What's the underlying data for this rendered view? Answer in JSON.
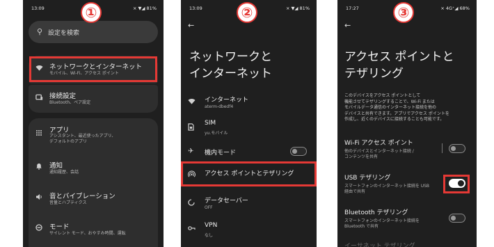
{
  "steps": [
    "①",
    "②",
    "③"
  ],
  "screen1": {
    "status": {
      "time": "13:09",
      "icons": "⨯ ▼◢ 81%"
    },
    "search_icon": "search-icon",
    "search_placeholder": "設定を検索",
    "items": [
      {
        "title": "ネットワークとインターネット",
        "subtitle": "モバイル、Wi-Fi、アクセス ポイント",
        "icon": "wifi-icon"
      },
      {
        "title": "接続設定",
        "subtitle": "Bluetooth、ペア設定",
        "icon": "devices-icon"
      },
      {
        "title": "アプリ",
        "subtitle": "アシスタント、最近使ったアプリ、デフォルトのアプリ",
        "subtitle1": "アシスタント、最近使ったアプリ、",
        "subtitle2": "デフォルトのアプリ",
        "icon": "apps-grid-icon"
      },
      {
        "title": "通知",
        "subtitle": "通知履歴、会話",
        "icon": "bell-icon"
      },
      {
        "title": "音とバイブレーション",
        "subtitle": "音量とハプティクス",
        "icon": "volume-icon"
      },
      {
        "title": "モード",
        "subtitle": "サイレント モード、おやすみ時間、運転",
        "icon": "mode-icon"
      }
    ]
  },
  "screen2": {
    "status": {
      "time": "13:09",
      "icons": "⨯ ▼◢ 81%"
    },
    "back": "←",
    "title_line1": "ネットワークと",
    "title_line2": "インターネット",
    "items": [
      {
        "title": "インターネット",
        "subtitle": "aterm-dbedf4",
        "icon": "wifi-icon"
      },
      {
        "title": "SIM",
        "subtitle": "yu.モバイル",
        "icon": "sim-icon"
      },
      {
        "title": "機内モード",
        "subtitle": "",
        "icon": "airplane-icon",
        "toggle": "off"
      },
      {
        "title": "アクセス ポイントとテザリング",
        "subtitle": "",
        "icon": "hotspot-icon"
      },
      {
        "title": "データセーバー",
        "subtitle": "OFF",
        "icon": "data-saver-icon"
      },
      {
        "title": "VPN",
        "subtitle": "なし",
        "icon": "vpn-icon"
      }
    ]
  },
  "screen3": {
    "status": {
      "time": "17:27",
      "icons": "⨯ 4G⁺◢ 68%"
    },
    "back": "←",
    "title_line1": "アクセス ポイントと",
    "title_line2": "テザリング",
    "description": [
      "このデバイスをアクセス ポイントとして",
      "機能させてテザリングすることで、Wi-Fi または",
      "モバイルデータ通信のインターネット接続を他の",
      "デバイスと共有できます。アプリでアクセス ポイントを",
      "作成し、近くのデバイスに接続することも可能です。"
    ],
    "items": [
      {
        "title": "Wi-Fi アクセス ポイント",
        "subtitle1": "他のデバイスとインターネット接続 /",
        "subtitle2": "コンテンツを共有",
        "toggle": "off"
      },
      {
        "title": "USB テザリング",
        "subtitle1": "スマートフォンのインターネット接続を USB",
        "subtitle2": "経由で共有",
        "toggle": "on"
      },
      {
        "title": "Bluetooth テザリング",
        "subtitle1": "スマートフォンのインターネット接続を",
        "subtitle2": "Bluetooth で共有",
        "toggle": "off"
      },
      {
        "title": "イーサネット テザリング"
      }
    ]
  },
  "colors": {
    "highlight": "#e53935",
    "background": "#1f1f1f",
    "card": "#2e2e2e"
  }
}
